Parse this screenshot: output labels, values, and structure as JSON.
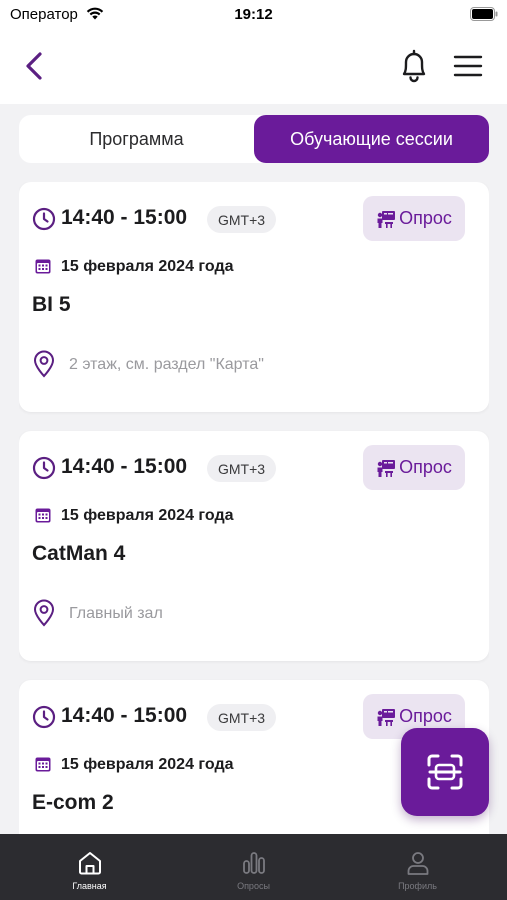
{
  "status_bar": {
    "carrier": "Оператор",
    "time": "19:12"
  },
  "nav": {
    "back_icon": "chevron-left-icon",
    "bell_icon": "bell-icon",
    "menu_icon": "hamburger-icon"
  },
  "segments": {
    "program": "Программа",
    "sessions": "Обучающие сессии",
    "active": "sessions"
  },
  "colors": {
    "accent": "#6a1b9a",
    "poll_bg": "#ebe4f1",
    "tab_bar": "#2c2c30"
  },
  "sessions": [
    {
      "time": "14:40 - 15:00",
      "tz": "GMT+3",
      "poll_label": "Опрос",
      "date": "15 февраля 2024 года",
      "title": "BI 5",
      "location": "2 этаж, см. раздел \"Карта\""
    },
    {
      "time": "14:40 - 15:00",
      "tz": "GMT+3",
      "poll_label": "Опрос",
      "date": "15 февраля 2024 года",
      "title": "CatMan 4",
      "location": "Главный зал"
    },
    {
      "time": "14:40 - 15:00",
      "tz": "GMT+3",
      "poll_label": "Опрос",
      "date": "15 февраля 2024 года",
      "title": "E-com 2",
      "location": ""
    }
  ],
  "tab_bar": {
    "home": "Главная",
    "polls": "Опросы",
    "profile": "Профиль",
    "active": "home"
  }
}
